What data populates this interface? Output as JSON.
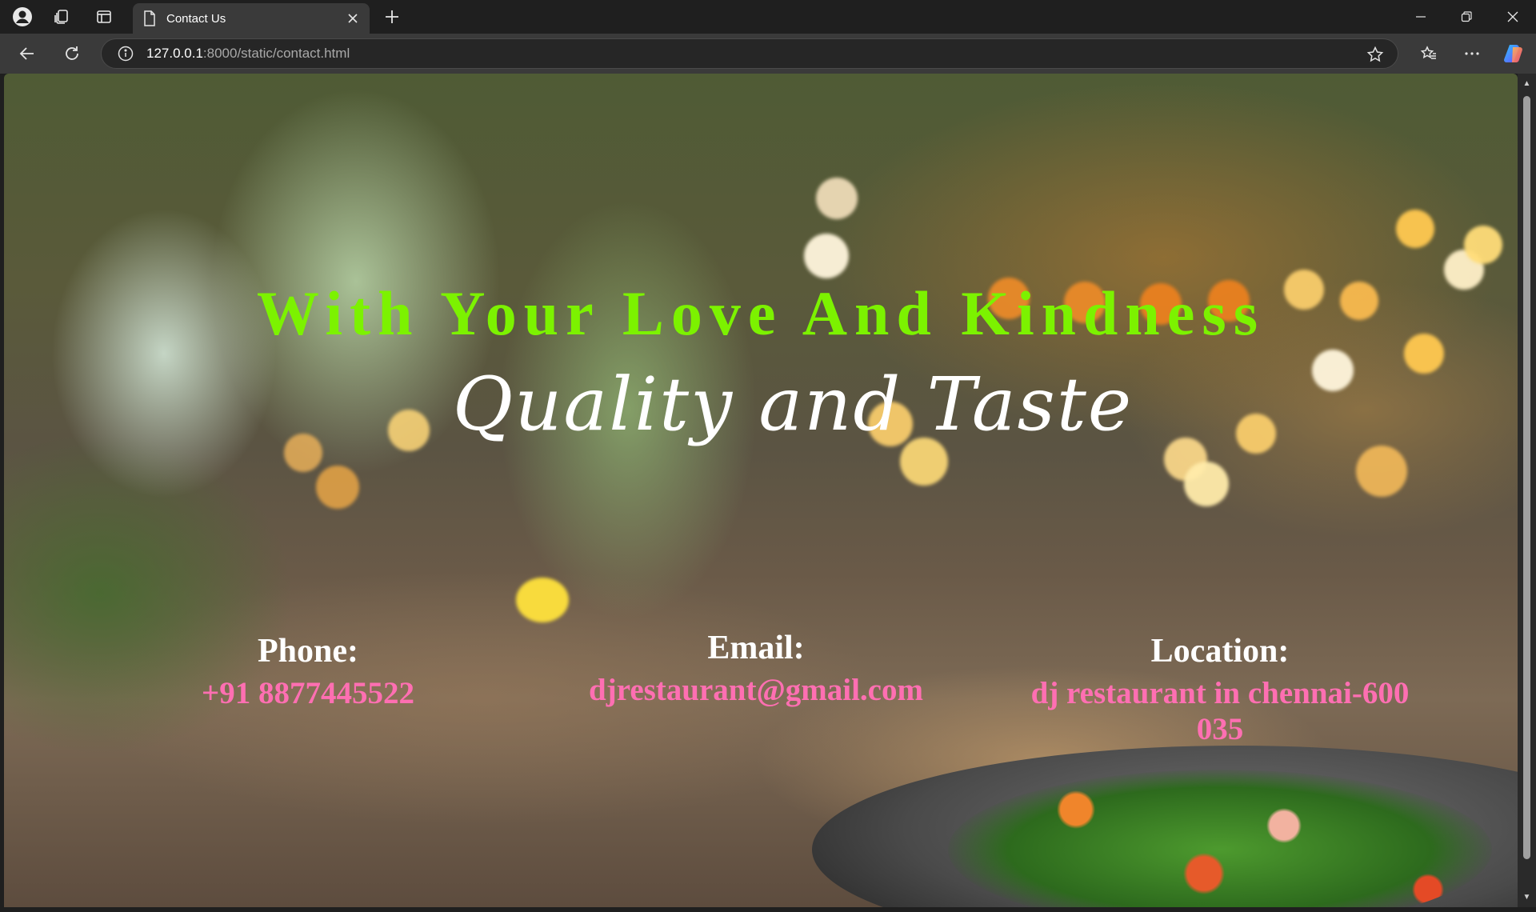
{
  "browser": {
    "tab_title": "Contact Us",
    "url_host": "127.0.0.1",
    "url_path": ":8000/static/contact.html"
  },
  "icons": {
    "profile": "profile-icon",
    "collections": "collections-icon",
    "tab_actions": "tab-actions-icon",
    "tab_page": "page-icon",
    "tab_close": "close-icon",
    "new_tab": "plus-icon",
    "minimize": "minimize-icon",
    "restore": "restore-icon",
    "window_close": "close-icon",
    "back": "back-arrow-icon",
    "reload": "reload-icon",
    "site_info": "info-icon",
    "favorite": "star-icon",
    "favorites": "favorites-icon",
    "more": "more-icon",
    "copilot": "copilot-icon"
  },
  "hero": {
    "line1": "With Your Love And Kindness",
    "line2": "Quality and Taste"
  },
  "contact": {
    "phone_label": "Phone:",
    "phone_value": "+91 8877445522",
    "email_label": "Email:",
    "email_value": "djrestaurant@gmail.com",
    "location_label": "Location:",
    "location_value": "dj restaurant in chennai-600 035"
  },
  "colors": {
    "headline": "#7cf200",
    "subheadline": "#ffffff",
    "label": "#ffffff",
    "value": "#ff6fb2",
    "chrome_bg": "#1f1f1f",
    "toolbar_bg": "#3a3a3a"
  }
}
